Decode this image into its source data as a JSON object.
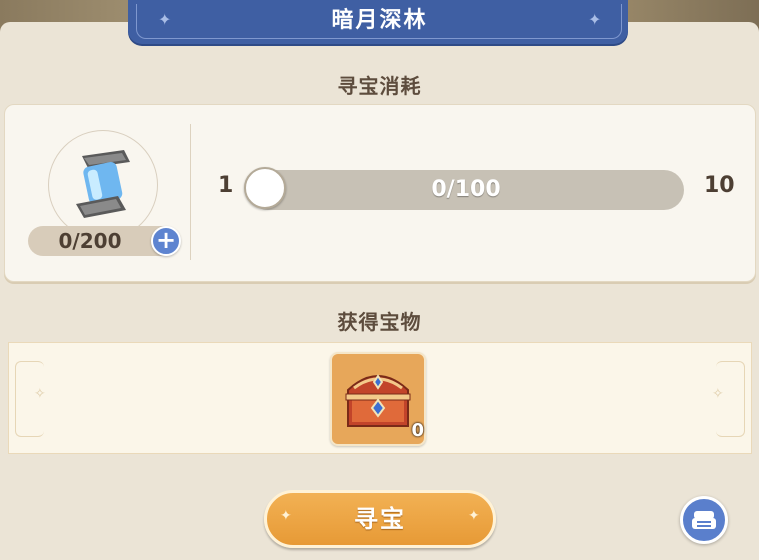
{
  "title": "暗月深林",
  "cost_section": {
    "title": "寻宝消耗",
    "item_icon": "energy-canister-icon",
    "item_count": "0/200",
    "plus_icon": "plus-icon",
    "slider": {
      "min_label": "1",
      "max_label": "10",
      "value_text": "0/100",
      "progress": 0
    }
  },
  "reward_section": {
    "title": "获得宝物",
    "reward_icon": "treasure-chest-icon",
    "reward_count": "0"
  },
  "actions": {
    "hunt_label": "寻宝",
    "corner_icon": "scroll-icon"
  },
  "colors": {
    "accent_blue": "#3f5fa3",
    "button_orange": "#e79a36",
    "panel": "#ebe4d6"
  }
}
